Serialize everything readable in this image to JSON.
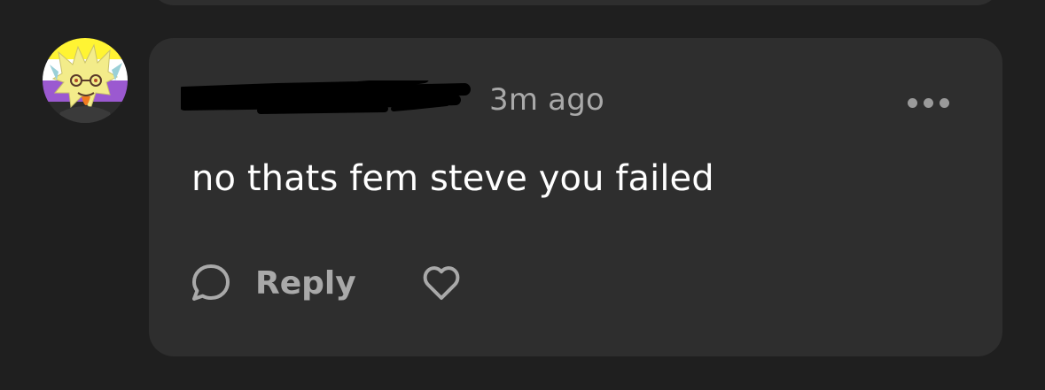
{
  "comment": {
    "timestamp": "3m ago",
    "text": "no thats fem steve you failed",
    "author_redacted": true
  },
  "actions": {
    "reply_label": "Reply",
    "reply_icon": "speech-bubble-icon",
    "like_icon": "heart-icon",
    "more_icon": "more-dots-icon"
  },
  "colors": {
    "background": "#1f1f1f",
    "card": "#2e2e2e",
    "text": "#ffffff",
    "muted": "#a9a9a9",
    "avatar_flag": [
      "#fff433",
      "#ffffff",
      "#9b59d0",
      "#2c2c2c"
    ]
  }
}
